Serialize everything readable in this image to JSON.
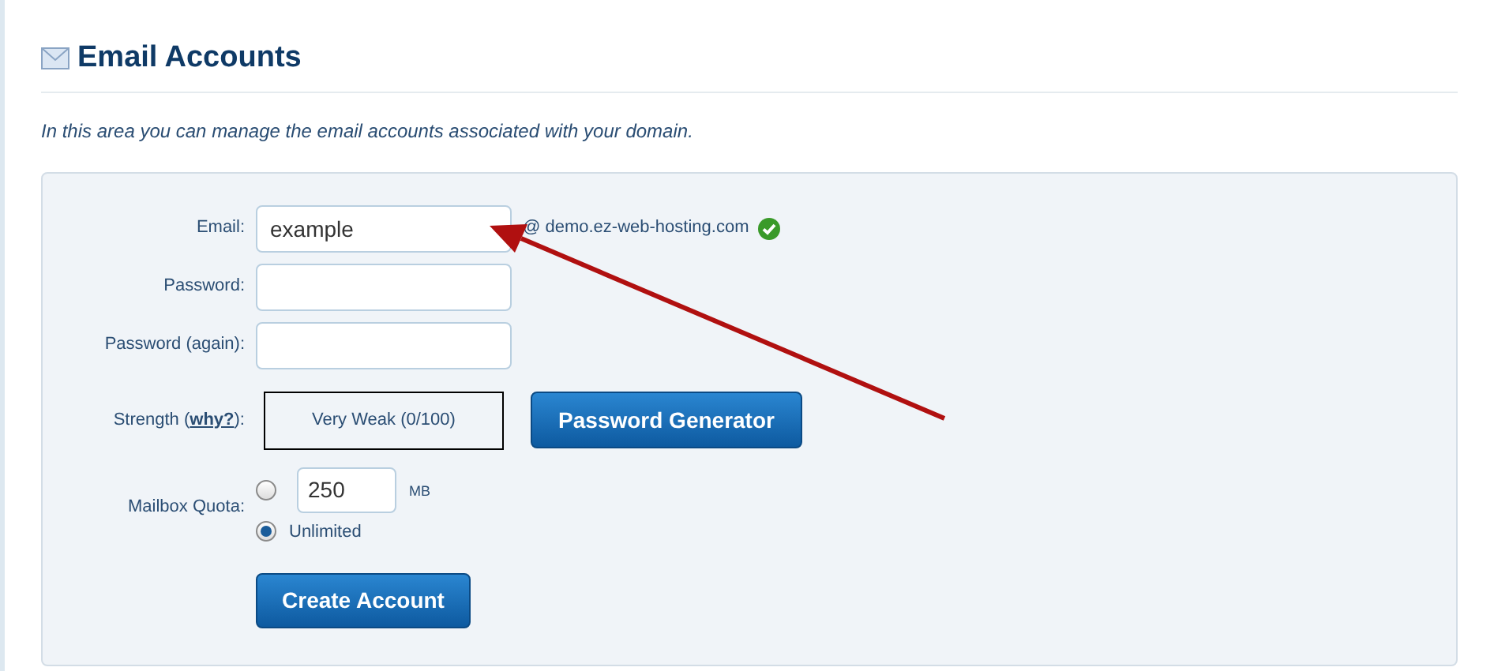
{
  "page": {
    "title": "Email Accounts",
    "intro": "In this area you can manage the email accounts associated with your domain."
  },
  "form": {
    "email": {
      "label": "Email:",
      "value": "example",
      "domain": "@ demo.ez-web-hosting.com",
      "valid": true
    },
    "password": {
      "label": "Password:"
    },
    "password_again": {
      "label": "Password (again):"
    },
    "strength": {
      "label_start": "Strength (",
      "link": "why?",
      "label_end": "):",
      "reading": "Very Weak (0/100)",
      "generator_button": "Password Generator"
    },
    "quota": {
      "label": "Mailbox Quota:",
      "options": [
        {
          "kind": "amount",
          "value": "250",
          "unit": "MB",
          "selected": false
        },
        {
          "kind": "unlimited",
          "label": "Unlimited",
          "selected": true
        }
      ]
    },
    "submit": "Create Account"
  }
}
